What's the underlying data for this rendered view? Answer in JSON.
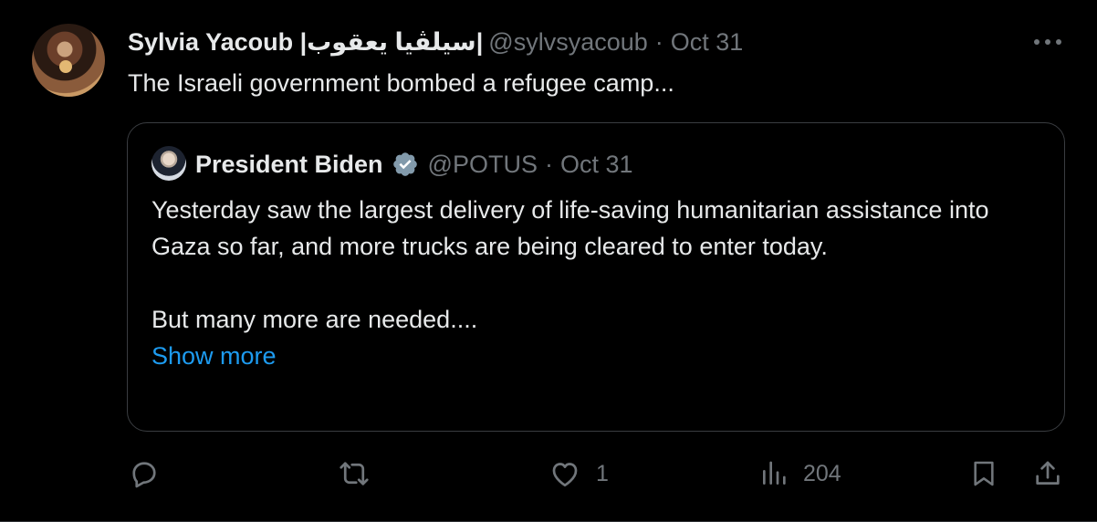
{
  "tweet": {
    "author": {
      "display_name": "Sylvia Yacoub |سيلڤيا يعقوب|",
      "handle": "@sylvsyacoub",
      "date": "Oct 31",
      "separator": "·"
    },
    "text": "The Israeli government bombed a refugee camp...",
    "more_icon": "more-horizontal-icon"
  },
  "quote": {
    "author": {
      "display_name": "President Biden",
      "handle": "@POTUS",
      "date": "Oct 31",
      "separator": "·",
      "verified_badge_icon": "government-verified-badge-icon",
      "badge_color": "#829aab"
    },
    "paragraph1": "Yesterday saw the largest delivery of life-saving humanitarian assistance into Gaza so far, and more trucks are being cleared to enter today.",
    "paragraph2": "But many more are needed....",
    "show_more": "Show more"
  },
  "actions": {
    "reply": {
      "icon": "reply-icon",
      "count": ""
    },
    "repost": {
      "icon": "repost-icon",
      "count": ""
    },
    "like": {
      "icon": "heart-icon",
      "count": "1"
    },
    "views": {
      "icon": "views-icon",
      "count": "204"
    },
    "bookmark": {
      "icon": "bookmark-icon"
    },
    "share": {
      "icon": "share-icon"
    }
  },
  "colors": {
    "background": "#000000",
    "text": "#e7e9ea",
    "muted": "#71767b",
    "link": "#1d9bf0",
    "border": "#2f3336"
  }
}
